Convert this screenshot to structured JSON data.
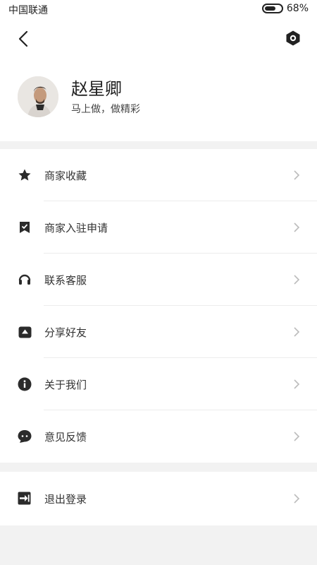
{
  "status_bar": {
    "carrier": "中国联通",
    "battery_text": "68%",
    "battery_level": 0.68
  },
  "nav": {
    "back_icon": "chevron-left-icon",
    "settings_icon": "settings-icon"
  },
  "profile": {
    "name": "赵星卿",
    "motto": "马上做，做精彩"
  },
  "menu": [
    {
      "label": "商家收藏",
      "icon": "star-icon"
    },
    {
      "label": "商家入驻申请",
      "icon": "bookmark-check-icon"
    },
    {
      "label": "联系客服",
      "icon": "headset-icon"
    },
    {
      "label": "分享好友",
      "icon": "share-icon"
    },
    {
      "label": "关于我们",
      "icon": "info-icon"
    },
    {
      "label": "意见反馈",
      "icon": "feedback-bubble-icon"
    }
  ],
  "logout": {
    "label": "退出登录",
    "icon": "logout-icon"
  }
}
